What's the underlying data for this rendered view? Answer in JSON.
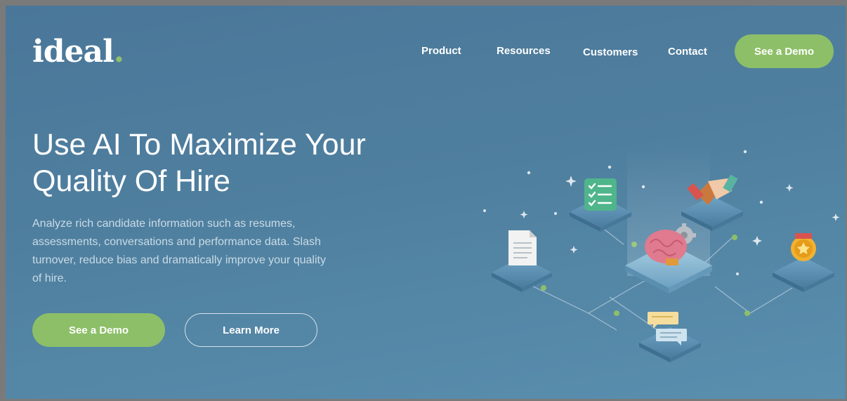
{
  "brand": {
    "name": "ideal",
    "dot": "."
  },
  "nav": {
    "items": [
      {
        "label": "Product"
      },
      {
        "label": "Resources"
      },
      {
        "label": "Customers"
      },
      {
        "label": "Contact"
      }
    ],
    "cta_label": "See a Demo"
  },
  "hero": {
    "title_line1": "Use AI To Maximize Your",
    "title_line2": "Quality Of Hire",
    "body": "Analyze rich candidate information such as resumes, assessments, conversations and performance data. Slash turnover, reduce bias and dramatically improve your quality of hire.",
    "primary_cta": "See a Demo",
    "secondary_cta": "Learn More"
  },
  "illustration": {
    "icons": [
      "document-icon",
      "checklist-icon",
      "brain-gear-icon",
      "handshake-icon",
      "award-medal-icon",
      "chat-bubbles-icon"
    ]
  },
  "colors": {
    "accent_green": "#8dbf68",
    "background": "#4f7f9f",
    "text": "#ffffff"
  }
}
